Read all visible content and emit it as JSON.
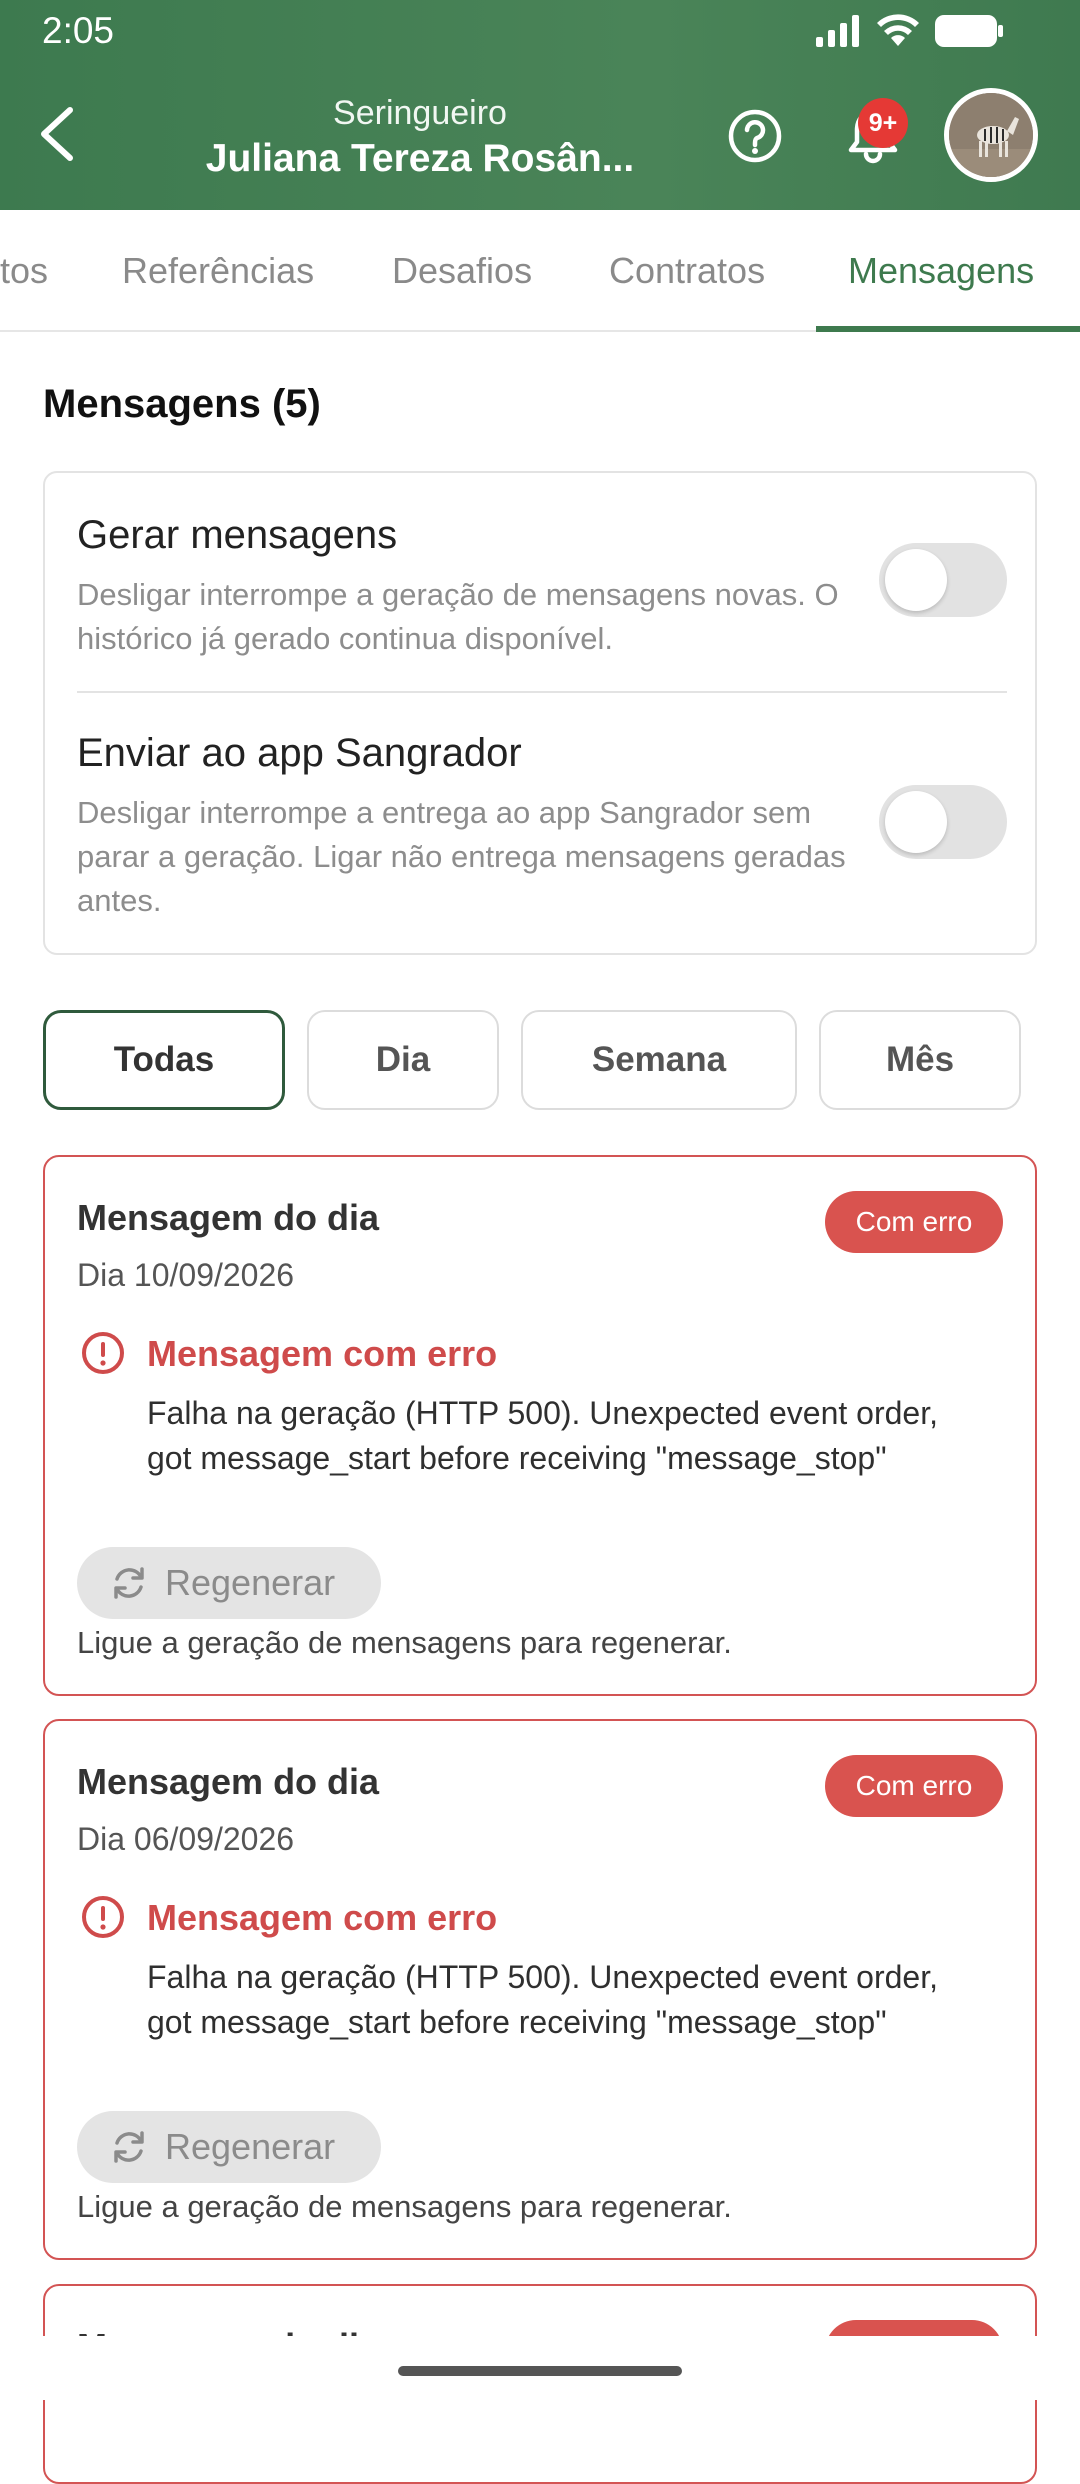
{
  "status_bar": {
    "time": "2:05"
  },
  "header": {
    "subtitle": "Seringueiro",
    "title": "Juliana Tereza Rosân...",
    "notification_badge": "9+",
    "icons": {
      "back": "chevron-left-icon",
      "help": "question-circle-icon",
      "bell": "bell-icon"
    }
  },
  "tabs": [
    {
      "label": "tos"
    },
    {
      "label": "Referências"
    },
    {
      "label": "Desafios"
    },
    {
      "label": "Contratos"
    },
    {
      "label": "Mensagens",
      "active": true
    }
  ],
  "section": {
    "title": "Mensagens (5)"
  },
  "settings": [
    {
      "label": "Gerar mensagens",
      "description": "Desligar interrompe a geração de mensagens novas. O histórico já gerado continua disponível.",
      "enabled": false
    },
    {
      "label": "Enviar ao app Sangrador",
      "description": "Desligar interrompe a entrega ao app Sangrador sem parar a geração. Ligar não entrega mensagens geradas antes.",
      "enabled": false
    }
  ],
  "filters": [
    {
      "label": "Todas",
      "active": true
    },
    {
      "label": "Dia"
    },
    {
      "label": "Semana"
    },
    {
      "label": "Mês"
    }
  ],
  "messages": [
    {
      "title": "Mensagem do dia",
      "date": "Dia 10/09/2026",
      "badge": "Com erro",
      "error_heading": "Mensagem com erro",
      "error_text": "Falha na geração (HTTP 500). Unexpected event order, got message_start before receiving \"message_stop\"",
      "regen_label": "Regenerar",
      "regen_hint": "Ligue a geração de mensagens para regenerar."
    },
    {
      "title": "Mensagem do dia",
      "date": "Dia 06/09/2026",
      "badge": "Com erro",
      "error_heading": "Mensagem com erro",
      "error_text": "Falha na geração (HTTP 500). Unexpected event order, got message_start before receiving \"message_stop\"",
      "regen_label": "Regenerar",
      "regen_hint": "Ligue a geração de mensagens para regenerar."
    },
    {
      "title": "Mensagem do dia",
      "badge": "Com erro"
    }
  ],
  "colors": {
    "header_green": "#3d7a4f",
    "accent_green": "#3e7a4e",
    "error_red": "#d9534f",
    "notification_red": "#e53935"
  }
}
